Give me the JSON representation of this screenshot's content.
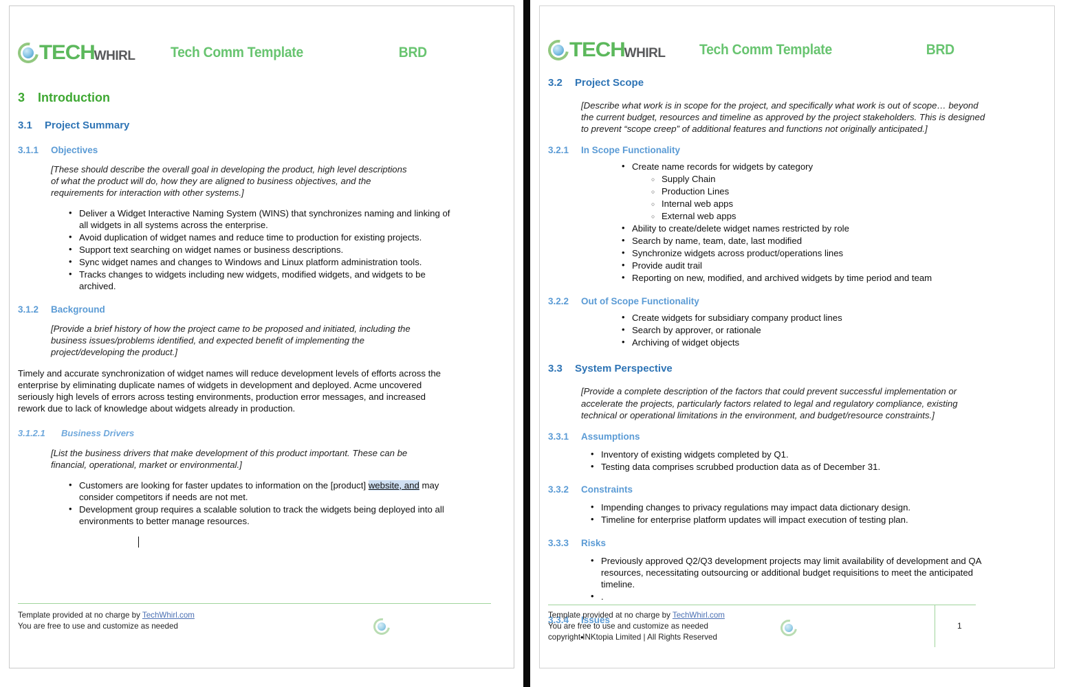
{
  "brand": {
    "logo_tech": "TECH",
    "logo_whirl": "WHIRL",
    "logo_icon": "techwhirl-swirl-globe-icon",
    "header_title": "Tech Comm Template",
    "header_doctype": "BRD",
    "green": "#5cb85c",
    "header_green": "#68c470",
    "gray": "#58595b"
  },
  "colors": {
    "h1": "#3ea832",
    "h2": "#2e74b5",
    "h3": "#5b9bd5",
    "h4": "#6fa8dc",
    "highlight": "#cfe0f3",
    "footer_rule": "#9fd49b",
    "link": "#4a6fb3"
  },
  "page_left": {
    "h1": {
      "num": "3",
      "text": "Introduction"
    },
    "s31": {
      "num": "3.1",
      "text": "Project Summary"
    },
    "s311": {
      "num": "3.1.1",
      "text": "Objectives"
    },
    "objectives_instruction": "[These should describe the overall goal in developing the product, high level descriptions of what the product will do, how they are aligned to business objectives, and the requirements for interaction with other systems.]",
    "objectives_bullets": [
      "Deliver a Widget Interactive Naming System (WINS) that synchronizes naming and linking of all widgets in all systems across the enterprise.",
      "Avoid duplication of widget names and reduce time to production for existing projects.",
      "Support text searching on widget names or business descriptions.",
      "Sync widget names and changes to Windows and Linux platform administration tools.",
      "Tracks changes to widgets including new widgets, modified widgets, and widgets to be archived."
    ],
    "s312": {
      "num": "3.1.2",
      "text": "Background"
    },
    "background_instruction": "[Provide a brief history of how the project came to be proposed and initiated, including the business issues/problems identified, and expected benefit of implementing the project/developing the product.]",
    "background_paragraph": "Timely and accurate synchronization of widget names will reduce development levels of efforts across the enterprise by eliminating duplicate names of widgets in development and deployed. Acme uncovered seriously high levels of errors across testing environments, production error messages, and increased rework due to lack of knowledge about widgets already in production.",
    "s3121": {
      "num": "3.1.2.1",
      "text": "Business Drivers"
    },
    "drivers_instruction": "[List the business drivers that make development of this product important. These can be financial, operational, market or environmental.]",
    "driver_bullet_1_pre": "Customers are looking for faster updates to information on the [product] ",
    "driver_bullet_1_highlight": "website, and",
    "driver_bullet_1_post": " may consider competitors if needs are not met.",
    "driver_bullet_2": "Development group requires a scalable solution to track the widgets being deployed into all environments to better manage resources.",
    "footer": {
      "line1_pre": "Template provided at no charge by ",
      "line1_link": "TechWhirl.com",
      "line2": "You are free to use and customize as needed"
    }
  },
  "page_right": {
    "s32": {
      "num": "3.2",
      "text": "Project Scope"
    },
    "scope_instruction": "[Describe what work is in scope for the project, and specifically what work is out of scope… beyond the current budget, resources and timeline as approved by the project stakeholders. This is designed to prevent “scope creep” of additional features and functions not originally anticipated.]",
    "s321": {
      "num": "3.2.1",
      "text": "In Scope Functionality"
    },
    "in_scope_first": "Create name records for widgets by category",
    "in_scope_sub": [
      "Supply Chain",
      "Production Lines",
      "Internal web apps",
      "External web apps"
    ],
    "in_scope_rest": [
      "Ability to create/delete widget names restricted by role",
      "Search by name, team, date, last modified",
      "Synchronize widgets across product/operations lines",
      "Provide audit trail",
      "Reporting on new, modified, and archived widgets by time period and team"
    ],
    "s322": {
      "num": "3.2.2",
      "text": "Out of Scope Functionality"
    },
    "out_scope_bullets": [
      "Create widgets for subsidiary company product lines",
      "Search by approver, or rationale",
      "Archiving of widget objects"
    ],
    "s33": {
      "num": "3.3",
      "text": "System Perspective"
    },
    "perspective_instruction": "[Provide a complete description of the factors that could prevent successful implementation or accelerate the projects, particularly factors related to legal and regulatory compliance, existing technical or operational limitations in the environment, and budget/resource constraints.]",
    "s331": {
      "num": "3.3.1",
      "text": "Assumptions"
    },
    "assumptions_bullets": [
      "Inventory of existing widgets completed by Q1.",
      "Testing data comprises scrubbed production data as of December 31."
    ],
    "s332": {
      "num": "3.3.2",
      "text": "Constraints"
    },
    "constraints_bullets": [
      "Impending changes to privacy regulations may impact data dictionary design.",
      "Timeline for enterprise platform updates will impact execution of testing plan."
    ],
    "s333": {
      "num": "3.3.3",
      "text": "Risks"
    },
    "risks_bullets": [
      "Previously approved Q2/Q3 development projects may limit availability of development and QA resources, necessitating outsourcing or additional budget requisitions to meet the anticipated timeline.",
      "."
    ],
    "s334": {
      "num": "3.3.4",
      "text": "Issues"
    },
    "issues_bullets": [
      ""
    ],
    "footer": {
      "line1_pre": "Template provided at no charge by ",
      "line1_link": "TechWhirl.com",
      "line2": "You are free to use and customize as needed",
      "line3": "copyright INKtopia Limited | All Rights Reserved",
      "page_number": "1"
    }
  }
}
